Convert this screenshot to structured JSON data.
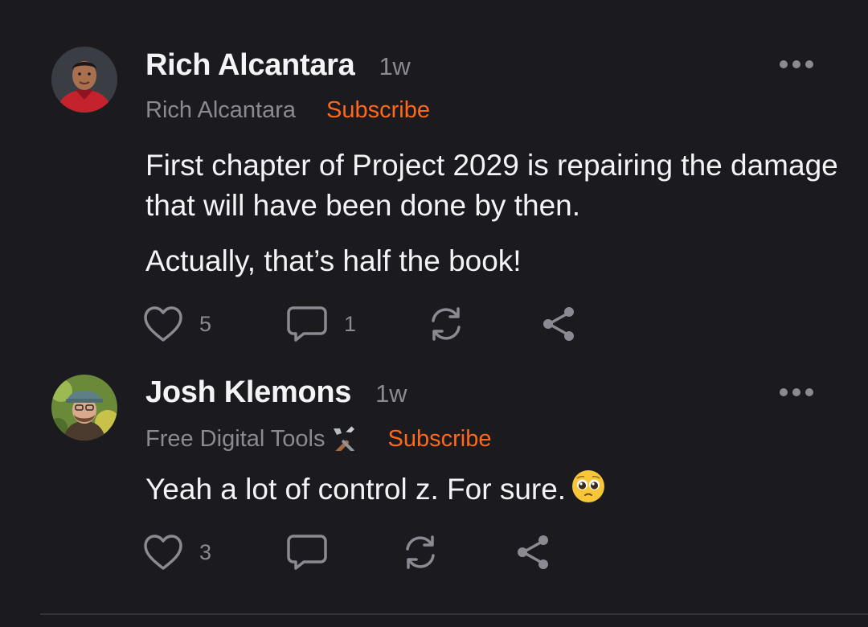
{
  "comments": [
    {
      "author": "Rich Alcantara",
      "time": "1w",
      "publication": "Rich Alcantara",
      "subscribe_label": "Subscribe",
      "paragraphs": [
        "First chapter of Project 2029 is repairing the damage that will have been done by then.",
        "Actually, that’s half the book!"
      ],
      "likes": "5",
      "replies": "1"
    },
    {
      "author": "Josh Klemons",
      "time": "1w",
      "publication": "Free Digital Tools",
      "publication_emoji": "tools-icon",
      "subscribe_label": "Subscribe",
      "paragraphs": [
        "Yeah a lot of control z. For sure."
      ],
      "body_emoji": "pleading-face-icon",
      "likes": "3",
      "replies": ""
    }
  ],
  "colors": {
    "background": "#1b1a1f",
    "accent": "#ff6719",
    "muted": "#8b8a92",
    "text": "#f4f4f6"
  }
}
